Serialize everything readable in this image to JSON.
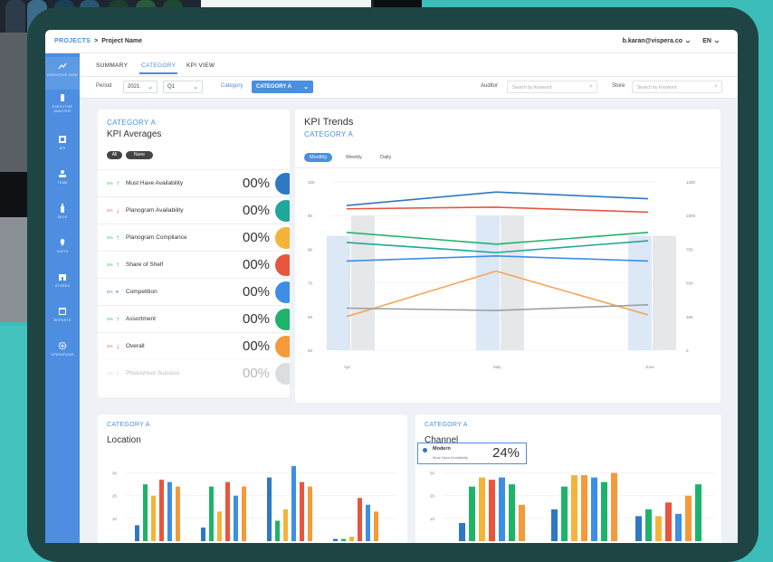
{
  "topbar": {
    "projects_label": "PROJECTS",
    "separator": ">",
    "project_name": "Project Name",
    "user_email": "b.karan@vispera.co",
    "language": "EN"
  },
  "sidebar": {
    "items": [
      {
        "icon": "chart-line-icon",
        "label": "EXECUTIVE VIEW"
      },
      {
        "icon": "bottle-icon",
        "label": "EXECUTIVE ANALYSIS"
      },
      {
        "icon": "kpi-icon",
        "label": "KPI"
      },
      {
        "icon": "users-icon",
        "label": "TEAM"
      },
      {
        "icon": "bottle-icon",
        "label": "SKUS"
      },
      {
        "icon": "map-pin-icon",
        "label": "VISITS"
      },
      {
        "icon": "store-icon",
        "label": "STORES"
      },
      {
        "icon": "calendar-icon",
        "label": "REPORTS"
      },
      {
        "icon": "gear-icon",
        "label": "OPERATIONS"
      }
    ]
  },
  "tabs": [
    "SUMMARY",
    "CATEGORY",
    "KPI VIEW"
  ],
  "filters": {
    "period_label": "Period",
    "year": "2021",
    "quarter": "Q1",
    "category_label": "Category",
    "category_value": "CATEGORY A",
    "auditor_label": "Auditor",
    "auditor_placeholder": "Search by Keyword",
    "store_label": "Store",
    "store_placeholder": "Search by Keyword"
  },
  "kpi_averages": {
    "category": "CATEGORY A",
    "title": "KPI Averages",
    "pills": [
      "All",
      "None"
    ],
    "rows": [
      {
        "change": "1%",
        "direction": "up",
        "name": "Must Have Availability",
        "value": "00%",
        "color": "#2e78c4"
      },
      {
        "change": "1%",
        "direction": "down",
        "name": "Planogram Availability",
        "value": "00%",
        "color": "#1fa79b"
      },
      {
        "change": "1%",
        "direction": "up",
        "name": "Planogram Compliance",
        "value": "00%",
        "color": "#f4b43a"
      },
      {
        "change": "1%",
        "direction": "up",
        "name": "Share of Shelf",
        "value": "00%",
        "color": "#e8553f"
      },
      {
        "change": "0%",
        "direction": "flat",
        "name": "Competition",
        "value": "00%",
        "color": "#3d8ee6"
      },
      {
        "change": "1%",
        "direction": "up",
        "name": "Assortment",
        "value": "00%",
        "color": "#1fb36a"
      },
      {
        "change": "1%",
        "direction": "down",
        "name": "Overall",
        "value": "00%",
        "color": "#f49a3a"
      },
      {
        "change": "1%",
        "direction": "up",
        "name": "Photoshoot Success",
        "value": "00%",
        "color": "#9aa0a6"
      }
    ]
  },
  "kpi_trends": {
    "title": "KPI Trends",
    "category": "CATEGORY A",
    "period_tabs": [
      "Monthly",
      "Weekly",
      "Daily"
    ]
  },
  "location_card": {
    "category": "CATEGORY A",
    "title": "Location"
  },
  "channel_card": {
    "category": "CATEGORY A",
    "title": "Channel"
  },
  "tooltip": {
    "label": "Modern",
    "sub": "Must Have Availability",
    "value": "24%"
  },
  "colors": {
    "accent": "#4a8fe0",
    "sidebar": "#4d8ee0",
    "up": "#1fb36a",
    "down": "#e8553f"
  },
  "chart_data": [
    {
      "type": "line",
      "categories": [
        "Apr",
        "May",
        "June"
      ],
      "ylim": [
        50,
        100
      ],
      "y2lim": [
        0,
        1250
      ],
      "y_ticks": [
        "100",
        "90",
        "80",
        "70",
        "60",
        "50"
      ],
      "y2_ticks": [
        "1250",
        "1000",
        "750",
        "500",
        "250",
        "0"
      ],
      "bars_right_axis": [
        {
          "color": "#dde8f7",
          "values": [
            850,
            1000,
            850
          ]
        },
        {
          "color": "#e6e7e9",
          "values": [
            1000,
            1000,
            850
          ]
        }
      ],
      "series": [
        {
          "color": "#2e78c4",
          "values": [
            93,
            97,
            95
          ]
        },
        {
          "color": "#e8553f",
          "values": [
            92,
            92.5,
            91
          ]
        },
        {
          "color": "#1fb36a",
          "values": [
            85,
            81.5,
            85
          ]
        },
        {
          "color": "#1fa79b",
          "values": [
            82,
            79,
            82.5
          ]
        },
        {
          "color": "#3d8ee6",
          "values": [
            76.5,
            78,
            76.5
          ]
        },
        {
          "color": "#f4a65e",
          "values": [
            60,
            73.5,
            60.5
          ]
        },
        {
          "color": "#9aa0a6",
          "values": [
            62.5,
            61.8,
            63.5
          ]
        }
      ],
      "grid": true,
      "legend": "none"
    },
    {
      "type": "bar",
      "title": "Location",
      "y_ticks": [
        "30",
        "20",
        "10"
      ],
      "ylim": [
        0,
        35
      ],
      "groups": [
        {
          "values": [
            7,
            25,
            20,
            27,
            26,
            24
          ],
          "colors": [
            "#2e78c4",
            "#1fb36a",
            "#f4b43a",
            "#e8553f",
            "#3d8ee6",
            "#f49a3a"
          ]
        },
        {
          "values": [
            6,
            24,
            13,
            26,
            20,
            24
          ],
          "colors": [
            "#2e78c4",
            "#1fb36a",
            "#f4b43a",
            "#e8553f",
            "#3d8ee6",
            "#f49a3a"
          ]
        },
        {
          "values": [
            28,
            9,
            14,
            33,
            26,
            24
          ],
          "colors": [
            "#2e78c4",
            "#1fb36a",
            "#f4b43a",
            "#3d8ee6",
            "#e8553f",
            "#f49a3a"
          ]
        },
        {
          "values": [
            1,
            1,
            2,
            19,
            16,
            13
          ],
          "colors": [
            "#2e78c4",
            "#1fb36a",
            "#f4b43a",
            "#e8553f",
            "#3d8ee6",
            "#f49a3a"
          ]
        }
      ]
    },
    {
      "type": "bar",
      "title": "Channel",
      "y_ticks": [
        "30",
        "20",
        "10"
      ],
      "ylim": [
        0,
        35
      ],
      "groups": [
        {
          "values": [
            8,
            24,
            28,
            27,
            28,
            25,
            16
          ],
          "colors": [
            "#2e78c4",
            "#1fb36a",
            "#f4b43a",
            "#e8553f",
            "#3d8ee6",
            "#1fb36a",
            "#f49a3a"
          ]
        },
        {
          "values": [
            14,
            24,
            29,
            29,
            28,
            26,
            30
          ],
          "colors": [
            "#2e78c4",
            "#1fb36a",
            "#f4b43a",
            "#f49a3a",
            "#3d8ee6",
            "#1fb36a",
            "#f49a3a"
          ]
        },
        {
          "values": [
            11,
            14,
            11,
            17,
            12,
            20,
            25
          ],
          "colors": [
            "#2e78c4",
            "#1fb36a",
            "#f4b43a",
            "#e8553f",
            "#3d8ee6",
            "#f49a3a",
            "#1fb36a"
          ]
        }
      ]
    }
  ]
}
